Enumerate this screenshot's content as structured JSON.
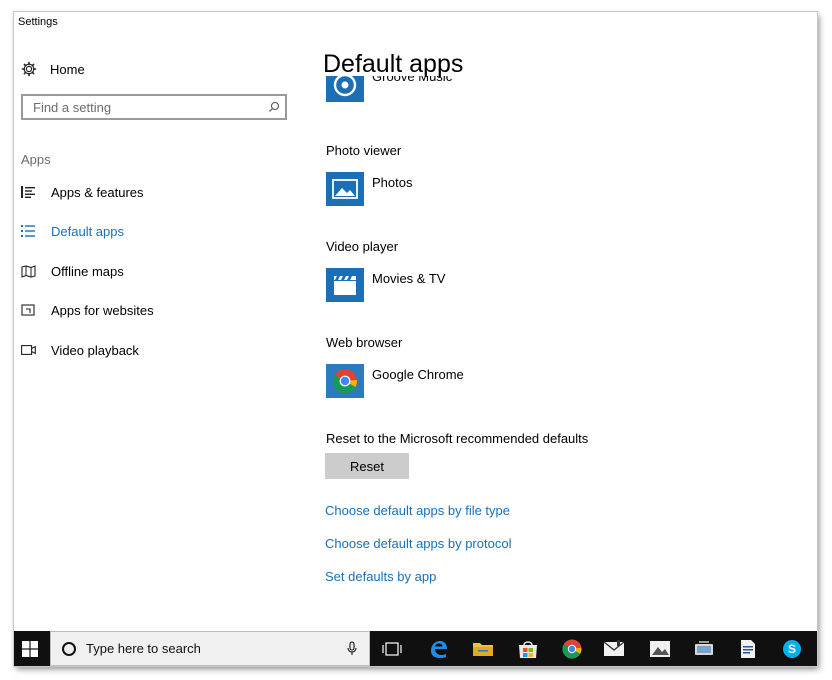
{
  "window": {
    "title": "Settings"
  },
  "sidebar": {
    "home_label": "Home",
    "search_placeholder": "Find a setting",
    "section_label": "Apps",
    "items": [
      {
        "label": "Apps & features",
        "icon": "list-icon",
        "active": false
      },
      {
        "label": "Default apps",
        "icon": "default-apps-icon",
        "active": true
      },
      {
        "label": "Offline maps",
        "icon": "map-icon",
        "active": false
      },
      {
        "label": "Apps for websites",
        "icon": "website-icon",
        "active": false
      },
      {
        "label": "Video playback",
        "icon": "video-icon",
        "active": false
      }
    ]
  },
  "main": {
    "title": "Default apps",
    "music": {
      "app": "Groove Music"
    },
    "photo": {
      "label": "Photo viewer",
      "app": "Photos"
    },
    "video": {
      "label": "Video player",
      "app": "Movies & TV"
    },
    "web": {
      "label": "Web browser",
      "app": "Google Chrome"
    },
    "reset": {
      "label": "Reset to the Microsoft recommended defaults",
      "button": "Reset"
    },
    "links": [
      "Choose default apps by file type",
      "Choose default apps by protocol",
      "Set defaults by app"
    ]
  },
  "taskbar": {
    "search_placeholder": "Type here to search",
    "icons": [
      "windows-start-icon",
      "task-view-icon",
      "edge-icon",
      "file-explorer-icon",
      "store-icon",
      "chrome-icon",
      "mail-icon",
      "photos-icon",
      "network-icon",
      "document-icon",
      "skype-icon"
    ]
  },
  "colors": {
    "accent": "#1a6fb7",
    "taskbar": "#101010",
    "button": "#cccccc"
  }
}
